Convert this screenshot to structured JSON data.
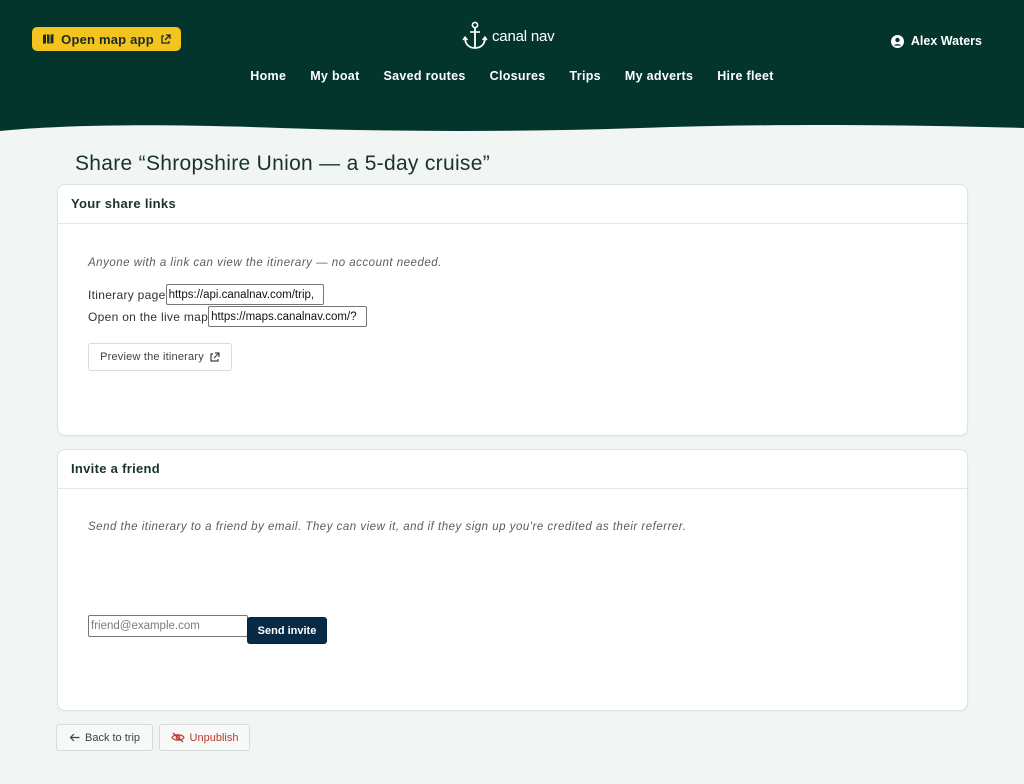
{
  "header": {
    "open_map_label": "Open map app",
    "brand_name": "canal nav",
    "user_name": "Alex Waters",
    "nav": [
      {
        "label": "Home"
      },
      {
        "label": "My boat"
      },
      {
        "label": "Saved routes"
      },
      {
        "label": "Closures"
      },
      {
        "label": "Trips"
      },
      {
        "label": "My adverts"
      },
      {
        "label": "Hire fleet"
      }
    ],
    "colors": {
      "header_bg": "#04352d",
      "cta_bg": "#f2c41d"
    }
  },
  "page": {
    "title": "Share “Shropshire Union — a 5-day cruise”"
  },
  "share_links": {
    "heading": "Your share links",
    "hint": "Anyone with a link can view the itinerary — no account needed.",
    "itinerary_label": "Itinerary page",
    "itinerary_url": "https://api.canalnav.com/trip,",
    "map_label": "Open on the live map",
    "map_url": "https://maps.canalnav.com/?",
    "preview_label": "Preview the itinerary"
  },
  "invite": {
    "heading": "Invite a friend",
    "hint": "Send the itinerary to a friend by email. They can view it, and if they sign up you're credited as their referrer.",
    "email_placeholder": "friend@example.com",
    "send_label": "Send invite"
  },
  "footer": {
    "back_label": "Back to trip",
    "unpublish_label": "Unpublish"
  }
}
